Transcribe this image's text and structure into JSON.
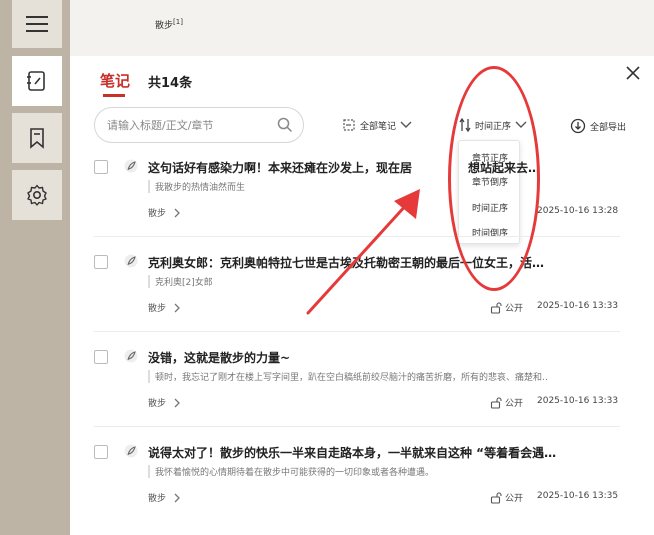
{
  "background": {
    "text": "散步",
    "footnote_mark": "[1]"
  },
  "panel": {
    "tab_label": "笔记",
    "count_label": "共14条",
    "search_placeholder": "请输入标题/正文/章节",
    "filter_label": "全部笔记",
    "sort_label": "时间正序",
    "export_label": "全部导出",
    "sort_options": [
      "章节正序",
      "章节倒序",
      "时间正序",
      "时间倒序"
    ]
  },
  "notes": [
    {
      "title": "这句话好有感染力啊！本来还瘫在沙发上，现在居然……想站起来去……",
      "title_left": "这句话好有感染力啊！本来还瘫在沙发上，现在居",
      "title_right": "想站起来去…",
      "quote": "我散步的热情油然而生",
      "chapter": "散步",
      "visibility": "",
      "time": "2025-10-16 13:28"
    },
    {
      "title": "克利奥女郎：克利奥帕特拉七世是古埃及托勒密王朝的最后一位女王，活…",
      "title_left": "克利奥女郎：克利奥帕特拉七世是古埃及托勒密王",
      "title_right": "朝的最后一位女王，活…",
      "quote": "克利奥[2]女郎",
      "chapter": "散步",
      "visibility": "公开",
      "time": "2025-10-16 13:33"
    },
    {
      "title": "没错，这就是散步的力量~",
      "quote": "顿时，我忘记了刚才在楼上写字间里，趴在空白稿纸前绞尽脑汁的痛苦折磨，所有的悲哀、痛楚和…",
      "chapter": "散步",
      "visibility": "公开",
      "time": "2025-10-16 13:33"
    },
    {
      "title": "说得太对了！散步的快乐一半来自走路本身，一半就来自这种 “等着看会遇…",
      "quote": "我怀着愉悦的心情期待着在散步中可能获得的一切印象或者各种遭遇。",
      "chapter": "散步",
      "visibility": "公开",
      "time": "2025-10-16 13:35"
    }
  ],
  "colors": {
    "accent": "#c8302c",
    "annotation_red": "#e5393a"
  },
  "icons": [
    "menu-icon",
    "notes-icon",
    "bookmark-icon",
    "settings-icon",
    "close-icon",
    "search-icon",
    "filter-icon",
    "sort-icon",
    "chevron-down-icon",
    "export-icon",
    "quill-icon",
    "chevron-right-icon",
    "lock-open-icon"
  ]
}
